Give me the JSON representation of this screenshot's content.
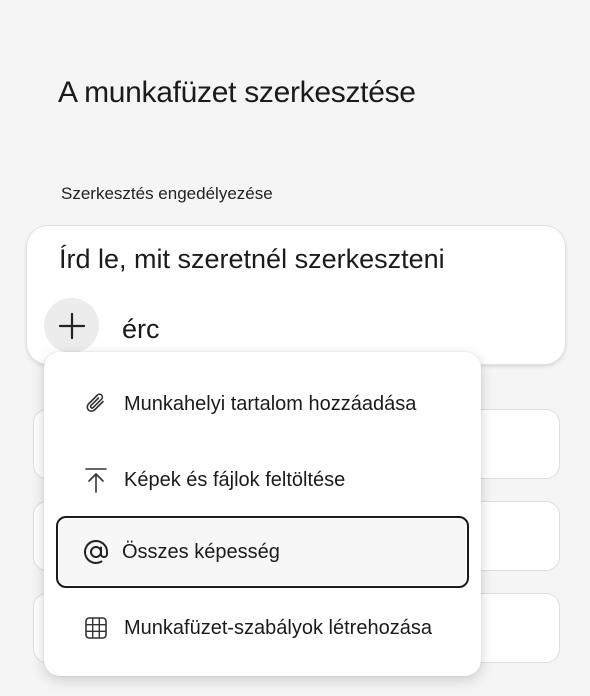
{
  "dialog": {
    "title": "A munkafüzet szerkesztése",
    "subtitle": "Szerkesztés engedélyezése"
  },
  "prompt": {
    "placeholder_text": "Írd le, mit szeretnél szerkeszteni",
    "typed_text": "érc",
    "plus_icon": "plus-icon"
  },
  "menu": {
    "items": [
      {
        "label": "Munkahelyi tartalom hozzáadása",
        "icon": "paperclip-icon"
      },
      {
        "label": "Képek és fájlok feltöltése",
        "icon": "upload-icon"
      },
      {
        "label": "Összes képesség",
        "icon": "at-sign-icon",
        "selected": true
      },
      {
        "label": "Munkafüzet-szabályok létrehozása",
        "icon": "grid-icon"
      }
    ]
  }
}
